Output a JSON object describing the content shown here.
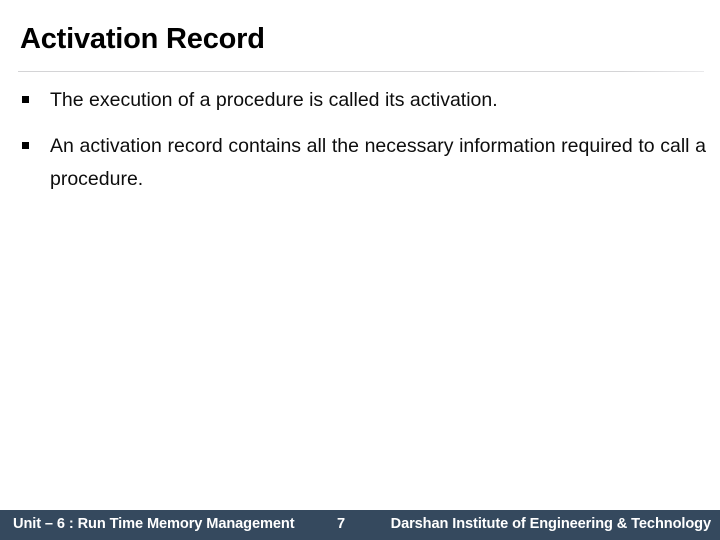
{
  "slide": {
    "title": "Activation Record",
    "background_color": "#ffffff",
    "divider_color": "#d4d4d6"
  },
  "content": {
    "bullet_glyph": "square-bullet",
    "bullets": [
      {
        "text": "The execution of a procedure is called its activation.",
        "align": "left"
      },
      {
        "text": "An activation record contains all the necessary information required to call a procedure.",
        "align": "justify"
      }
    ]
  },
  "footer": {
    "unit_label": "Unit – 6 : Run Time Memory Management",
    "page_number": "7",
    "organization": "Darshan Institute of Engineering & Technology",
    "background_color": "#35495e",
    "text_color": "#ffffff"
  }
}
